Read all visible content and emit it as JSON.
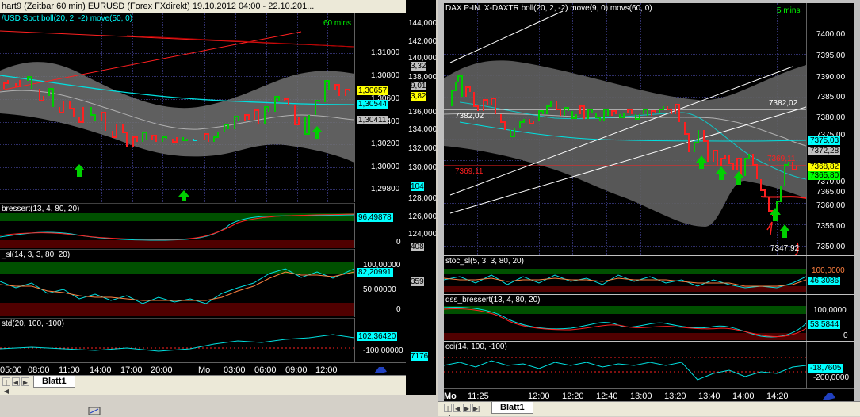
{
  "left_window": {
    "title": "hart9 (Zeitbar 60 min)  EURUSD (Forex FXdirekt) 19.10.2012 04:00 - 22.10.201...",
    "main_pane": {
      "indicator_title": "/USD Spot  boll(20, 2, -2)  move(50, 0)",
      "timeframe": "60 mins",
      "price_ticks": [
        "1,31000",
        "1,30800",
        "1,30600",
        "1,30400",
        "1,30200",
        "1,30000",
        "1,29800"
      ],
      "badges": [
        {
          "text": "1,30657",
          "bg": "#ffff00"
        },
        {
          "text": "1,30544",
          "bg": "#00ffff"
        },
        {
          "text": "1,30411",
          "bg": "#c0c0c0"
        }
      ]
    },
    "pane2": {
      "title": "bressert(13, 4, 80, 20)",
      "value": "96,49878",
      "tick": "0"
    },
    "pane3": {
      "title": "_sl(14, 3, 3, 80, 20)",
      "value": "82,20991",
      "tick_top": "100,00000",
      "tick_mid": "50,00000",
      "tick_bottom": "0"
    },
    "pane4": {
      "title": "std(20, 100, -100)",
      "value": "102,36420",
      "tick": "-100,00000"
    },
    "time_labels": [
      "05:00",
      "08:00",
      "11:00",
      "14:00",
      "17:00",
      "20:00",
      "Mo",
      "03:00",
      "06:00",
      "09:00",
      "12:00"
    ],
    "tab": "Blatt1"
  },
  "middle_strip": {
    "labels": [
      "144,000",
      "142,000",
      "140,000",
      "138,000",
      "136,000",
      "134,000",
      "132,000",
      "130,000",
      "128,000",
      "126,000",
      "124,000"
    ],
    "partial": [
      "3,32",
      "9,01",
      "3,82",
      "600",
      "400",
      "200",
      "020",
      "000",
      "0,0000",
      "104",
      "408",
      "359",
      "7176"
    ]
  },
  "right_window": {
    "main_pane": {
      "indicator_title": "DAX P-IN.  X-DAXTR  boll(20, 2, -2)  move(9, 0)  movs(60, 0)",
      "timeframe": "5 mins",
      "price_ticks": [
        "7400,00",
        "7395,00",
        "7390,00",
        "7385,00",
        "7380,00",
        "7375,00",
        "7370,00",
        "7365,00",
        "7360,00",
        "7355,00",
        "7350,00"
      ],
      "annotations": {
        "line_left": "7382,02",
        "line_right": "7382,02",
        "red_left": "7369,11",
        "red_right": "7369,11",
        "low": "7347,92"
      },
      "badges": [
        {
          "text": "7375,03",
          "bg": "#00ffff"
        },
        {
          "text": "7372,28",
          "bg": "#c0c0c0"
        },
        {
          "text": "7368,82",
          "bg": "#ffff00"
        },
        {
          "text": "7365,80",
          "bg": "#00ff00"
        }
      ]
    },
    "pane2": {
      "title": "stoc_sl(5, 3, 3, 80, 20)",
      "value": "46,3086",
      "tick_top": "100,0000"
    },
    "pane3": {
      "title": "dss_bressert(13, 4, 80, 20)",
      "value": "53,5844",
      "tick_top": "100,0000",
      "tick_bottom": "0"
    },
    "pane4": {
      "title": "cci(14, 100, -100)",
      "value": "-18,7605",
      "tick_bottom": "-200,0000"
    },
    "time_labels": [
      "Mo",
      "11:25",
      "12:00",
      "12:20",
      "12:40",
      "13:00",
      "13:20",
      "13:40",
      "14:00",
      "14:20"
    ],
    "tab": "Blatt1"
  },
  "colors": {
    "bull": "#00cc00",
    "bear": "#ff2020",
    "band": "#808080",
    "cyan": "#00e0e0",
    "ema": "#c0c0c0"
  }
}
